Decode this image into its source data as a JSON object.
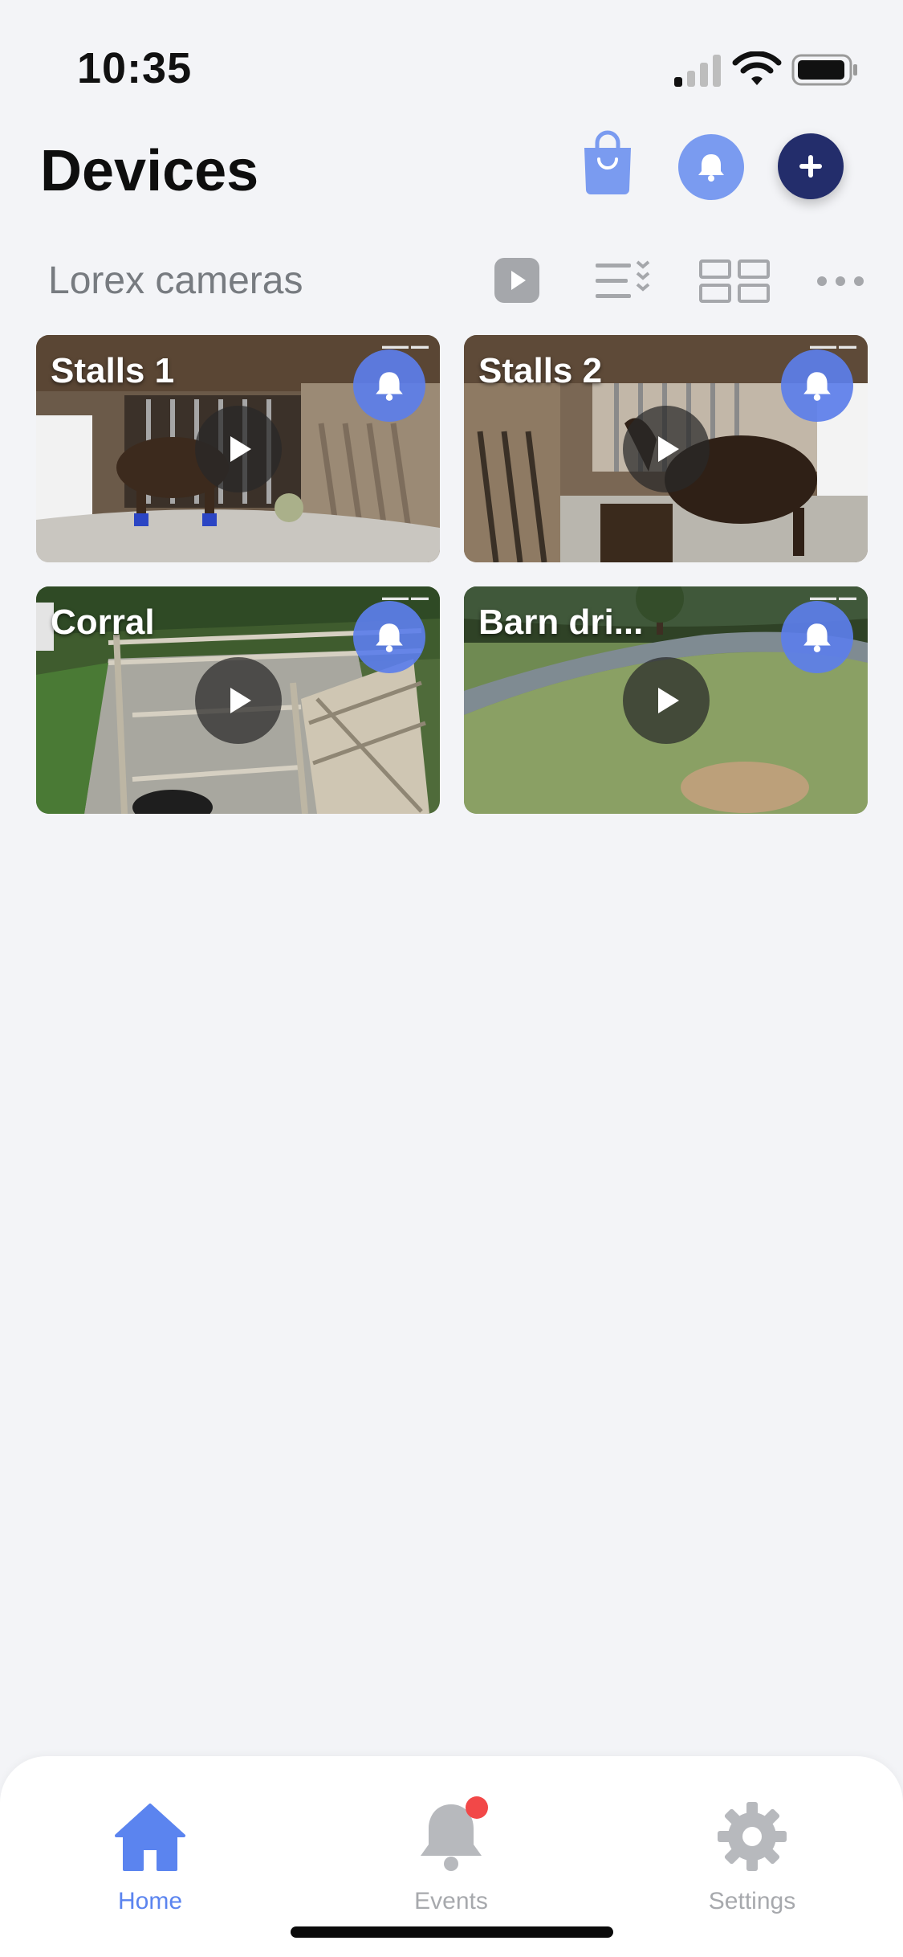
{
  "status_bar": {
    "time": "10:35",
    "icons": [
      "cellular-signal-icon",
      "wifi-icon",
      "battery-icon"
    ]
  },
  "header": {
    "title": "Devices",
    "buttons": [
      "shopping-bag-icon",
      "bell-icon",
      "plus-icon"
    ],
    "colors": {
      "bell_button": "#7a9bf0",
      "add_button": "#232d6b",
      "shop_icon": "#7a9bf0"
    }
  },
  "section": {
    "title": "Lorex cameras",
    "tools": [
      "play-all-icon",
      "list-view-icon",
      "grid-view-icon",
      "more-icon"
    ]
  },
  "cameras": [
    {
      "name": "Stalls 1",
      "bell_icon": "bell-icon",
      "play_icon": "play-icon"
    },
    {
      "name": "Stalls 2",
      "bell_icon": "bell-icon",
      "play_icon": "play-icon"
    },
    {
      "name": "Corral",
      "bell_icon": "bell-icon",
      "play_icon": "play-icon"
    },
    {
      "name": "Barn dri...",
      "bell_icon": "bell-icon",
      "play_icon": "play-icon"
    }
  ],
  "bottom_nav": {
    "items": [
      {
        "label": "Home",
        "icon": "home-icon",
        "active": true
      },
      {
        "label": "Events",
        "icon": "bell-icon",
        "badge": true
      },
      {
        "label": "Settings",
        "icon": "gear-icon"
      }
    ],
    "active_color": "#5b84ef",
    "inactive_color": "#a7a9ad",
    "badge_color": "#f24848"
  }
}
